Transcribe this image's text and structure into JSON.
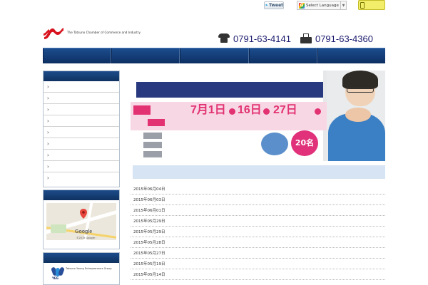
{
  "header": {
    "tagline": "",
    "tweet_label": "Tweet",
    "language_label": "Select Language",
    "mobile_site_label": "",
    "logo_name": "",
    "logo_english": "The Tatsuno Chamber of Commerce and Industry",
    "hours": "",
    "tel": "0791-63-4141",
    "fax": "0791-63-4360"
  },
  "nav": {
    "items": [
      {
        "label": ""
      },
      {
        "label": ""
      },
      {
        "label": ""
      },
      {
        "label": ""
      },
      {
        "label": ""
      }
    ]
  },
  "sidebar": {
    "menu_title": "",
    "items": [
      {
        "label": ""
      },
      {
        "label": ""
      },
      {
        "label": ""
      },
      {
        "label": ""
      },
      {
        "label": ""
      },
      {
        "label": ""
      },
      {
        "label": ""
      },
      {
        "label": ""
      },
      {
        "label": ""
      }
    ],
    "access_title": "",
    "map": {
      "label_station": "",
      "label_park": "",
      "label_area": "",
      "google": "Google",
      "copyright": "©2015 Google・"
    },
    "access_link": "",
    "youth_title": "",
    "youth_logo_abbr": "YEG",
    "youth_name": "",
    "youth_english": "Tatsuno Young Entrepreneurs Group"
  },
  "banner": {
    "tagline": "",
    "title": "",
    "date_tag": "",
    "era": "",
    "day1": "7月1日",
    "day1_dow": "",
    "day2": "16日",
    "day2_dow": "",
    "day3": "27日",
    "day3_dow": "",
    "sessions_tag": "",
    "sessions_note": "",
    "time": "",
    "info": [
      {
        "tag": "",
        "value": ""
      },
      {
        "tag": "",
        "value": ""
      },
      {
        "tag": "",
        "value": ""
      }
    ],
    "target_label": "",
    "target_value": "",
    "capacity_label": "",
    "capacity_value": "20名"
  },
  "news": {
    "heading": "",
    "items": [
      {
        "date": "2015年06月04日",
        "title": ""
      },
      {
        "date": "2015年06月03日",
        "title": ""
      },
      {
        "date": "2015年06月01日",
        "title": ""
      },
      {
        "date": "2015年05月29日",
        "title": ""
      },
      {
        "date": "2015年05月29日",
        "title": ""
      },
      {
        "date": "2015年05月28日",
        "title": ""
      },
      {
        "date": "2015年05月27日",
        "title": ""
      },
      {
        "date": "2015年05月19日",
        "title": ""
      },
      {
        "date": "2015年05月14日",
        "title": ""
      }
    ]
  },
  "colors": {
    "nav_blue": "#0d2f62",
    "accent_pink": "#e23272",
    "logo_red": "#d8121d",
    "link_blue": "#1a3e8a"
  }
}
